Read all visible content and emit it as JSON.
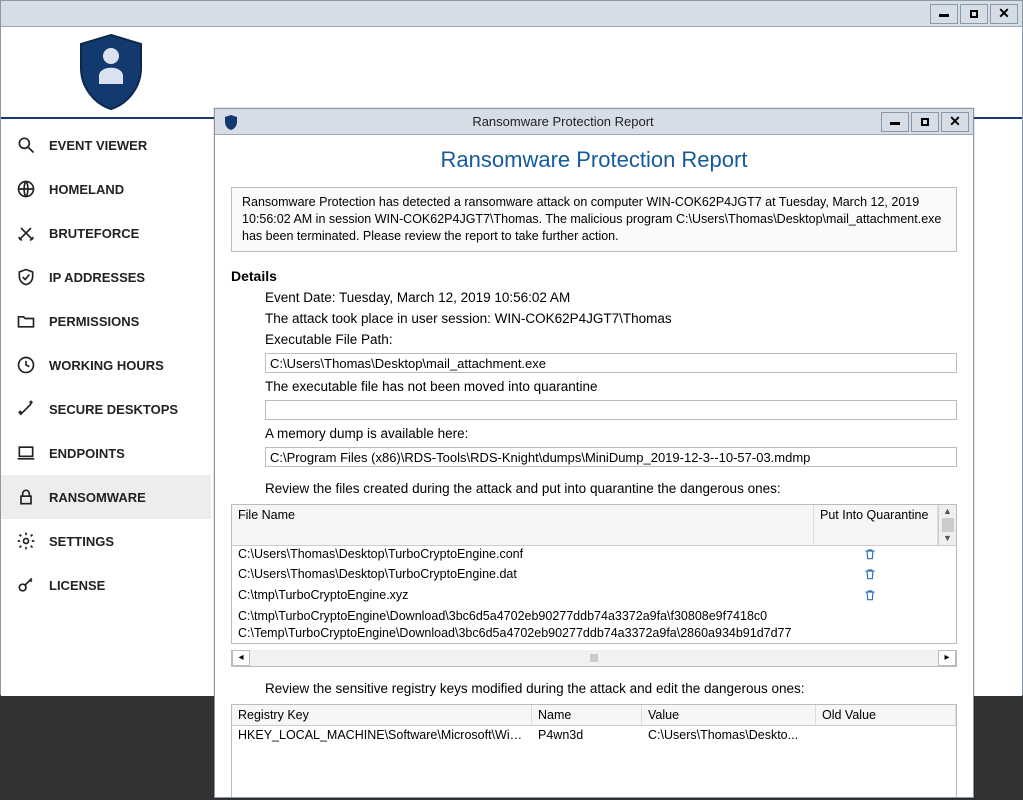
{
  "main_window": {
    "controls": {
      "minimize": "–",
      "maximize": "□",
      "close": "✕"
    }
  },
  "sidebar": {
    "items": [
      {
        "id": "event-viewer",
        "label": "EVENT VIEWER",
        "icon": "search"
      },
      {
        "id": "homeland",
        "label": "HOMELAND",
        "icon": "globe"
      },
      {
        "id": "bruteforce",
        "label": "BRUTEFORCE",
        "icon": "swords"
      },
      {
        "id": "ip-addresses",
        "label": "IP ADDRESSES",
        "icon": "shield-check"
      },
      {
        "id": "permissions",
        "label": "PERMISSIONS",
        "icon": "folder"
      },
      {
        "id": "working-hours",
        "label": "WORKING HOURS",
        "icon": "clock"
      },
      {
        "id": "secure-desktops",
        "label": "SECURE DESKTOPS",
        "icon": "wand"
      },
      {
        "id": "endpoints",
        "label": "ENDPOINTS",
        "icon": "laptop"
      },
      {
        "id": "ransomware",
        "label": "RANSOMWARE",
        "icon": "lock",
        "active": true
      },
      {
        "id": "settings",
        "label": "SETTINGS",
        "icon": "gear"
      },
      {
        "id": "license",
        "label": "LICENSE",
        "icon": "key"
      }
    ]
  },
  "report": {
    "window_title": "Ransomware Protection Report",
    "controls": {
      "minimize": "–",
      "maximize": "□",
      "close": "✕"
    },
    "heading": "Ransomware Protection Report",
    "summary": "Ransomware Protection has detected a ransomware attack on computer WIN-COK62P4JGT7 at Tuesday, March 12, 2019 10:56:02 AM in session WIN-COK62P4JGT7\\Thomas. The malicious program C:\\Users\\Thomas\\Desktop\\mail_attachment.exe has been terminated. Please review the report to take further action.",
    "details_label": "Details",
    "event_date_line": "Event Date: Tuesday, March 12, 2019 10:56:02 AM",
    "session_line": "The attack took place in user session: WIN-COK62P4JGT7\\Thomas",
    "exe_path_label": "Executable File Path:",
    "exe_path": "C:\\Users\\Thomas\\Desktop\\mail_attachment.exe",
    "quarantine_status": "The executable file has not been moved into quarantine",
    "quarantine_path": "",
    "memdump_label": "A memory dump is available here:",
    "memdump_path": "C:\\Program Files (x86)\\RDS-Tools\\RDS-Knight\\dumps\\MiniDump_2019-12-3--10-57-03.mdmp",
    "files_review_label": "Review the files created during the attack and put into quarantine the dangerous ones:",
    "files_columns": {
      "file": "File Name",
      "quarantine": "Put Into Quarantine"
    },
    "files": [
      {
        "path": "C:\\Users\\Thomas\\Desktop\\TurboCryptoEngine.conf",
        "quarantinable": true
      },
      {
        "path": "C:\\Users\\Thomas\\Desktop\\TurboCryptoEngine.dat",
        "quarantinable": true
      },
      {
        "path": "C:\\tmp\\TurboCryptoEngine.xyz",
        "quarantinable": true
      },
      {
        "path": "C:\\tmp\\TurboCryptoEngine\\Download\\3bc6d5a4702eb90277ddb74a3372a9fa\\f30808e9f7418c0",
        "quarantinable": false
      },
      {
        "path": "C:\\Temp\\TurboCryptoEngine\\Download\\3bc6d5a4702eb90277ddb74a3372a9fa\\2860a934b91d7d77",
        "quarantinable": false
      }
    ],
    "registry_review_label": "Review the sensitive registry keys modified during the attack and edit the dangerous ones:",
    "registry_columns": {
      "key": "Registry Key",
      "name": "Name",
      "value": "Value",
      "old": "Old Value"
    },
    "registry": [
      {
        "key": "HKEY_LOCAL_MACHINE\\Software\\Microsoft\\Windows\\...",
        "name": "P4wn3d",
        "value": "C:\\Users\\Thomas\\Deskto...",
        "old": ""
      }
    ]
  }
}
